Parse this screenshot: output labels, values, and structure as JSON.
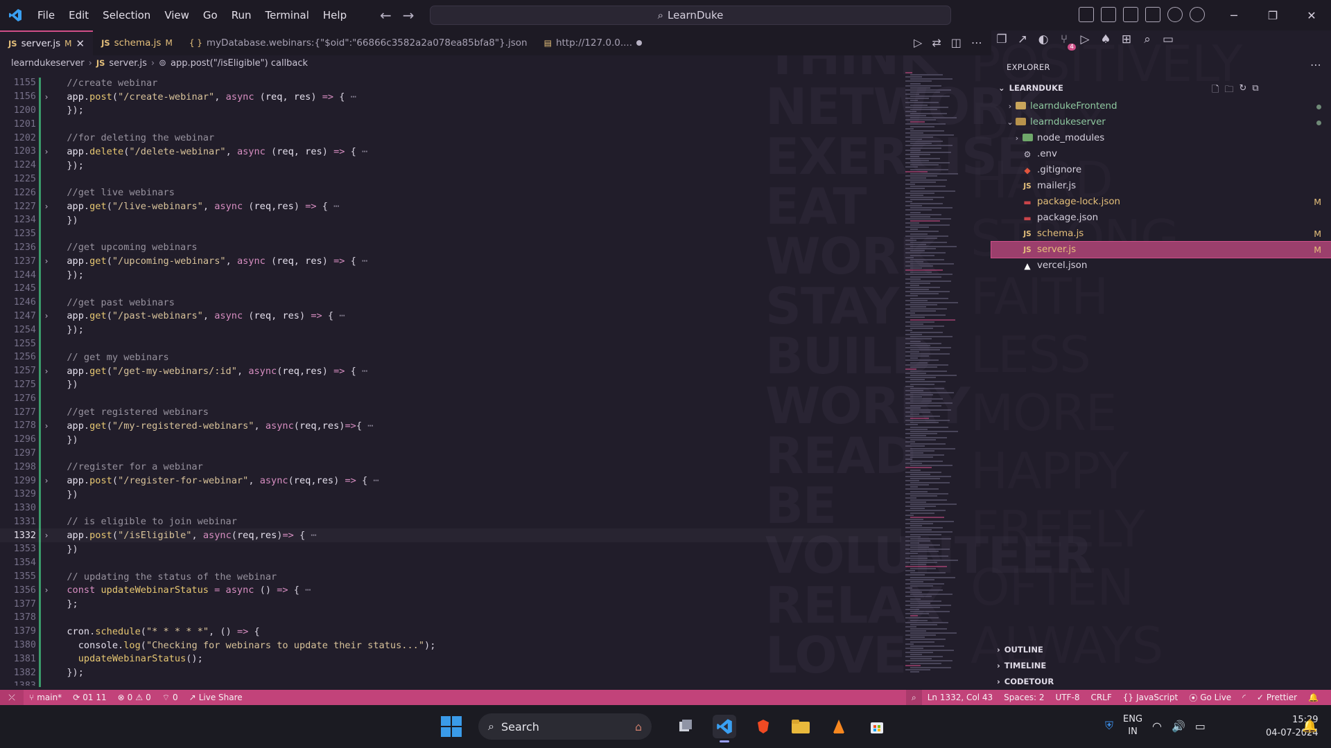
{
  "window": {
    "title": "LearnDuke",
    "menu": [
      "File",
      "Edit",
      "Selection",
      "View",
      "Go",
      "Run",
      "Terminal",
      "Help"
    ]
  },
  "tabs": [
    {
      "icon": "JS",
      "label": "server.js",
      "status": "M",
      "active": true
    },
    {
      "icon": "JS",
      "label": "schema.js",
      "status": "M",
      "active": false
    },
    {
      "icon": "{ }",
      "label": "myDatabase.webinars:{\"$oid\":\"66866c3582a2a078ea85bfa8\"}.json",
      "status": "",
      "active": false
    },
    {
      "icon": "",
      "label": "http://127.0.0....",
      "status": "",
      "active": false
    }
  ],
  "breadcrumb": {
    "folder": "learndukeserver",
    "file": "server.js",
    "symbol": "app.post(\"/isEligible\") callback"
  },
  "code_lines": [
    {
      "ln": "1155",
      "fold": "",
      "html": "  <span class='c'>//create webinar</span>"
    },
    {
      "ln": "1156",
      "fold": "›",
      "html": "  <span class='p'>app</span>.<span class='f'>post</span>(<span class='s'>\"/create-webinar\"</span>, <span class='k'>async</span> (<span class='p'>req</span>, <span class='p'>res</span>) <span class='k'>=&gt;</span> { <span class='ell'>⋯</span>"
    },
    {
      "ln": "1200",
      "fold": "",
      "html": "  });"
    },
    {
      "ln": "1201",
      "fold": "",
      "html": ""
    },
    {
      "ln": "1202",
      "fold": "",
      "html": "  <span class='c'>//for deleting the webinar</span>"
    },
    {
      "ln": "1203",
      "fold": "›",
      "html": "  <span class='p'>app</span>.<span class='f'>delete</span>(<span class='s'>\"/delete-webinar\"</span>, <span class='k'>async</span> (<span class='p'>req</span>, <span class='p'>res</span>) <span class='k'>=&gt;</span> { <span class='ell'>⋯</span>"
    },
    {
      "ln": "1224",
      "fold": "",
      "html": "  });"
    },
    {
      "ln": "1225",
      "fold": "",
      "html": ""
    },
    {
      "ln": "1226",
      "fold": "",
      "html": "  <span class='c'>//get live webinars</span>"
    },
    {
      "ln": "1227",
      "fold": "›",
      "html": "  <span class='p'>app</span>.<span class='f'>get</span>(<span class='s'>\"/live-webinars\"</span>, <span class='k'>async</span> (<span class='p'>req</span>,<span class='p'>res</span>) <span class='k'>=&gt;</span> { <span class='ell'>⋯</span>"
    },
    {
      "ln": "1234",
      "fold": "",
      "html": "  })"
    },
    {
      "ln": "1235",
      "fold": "",
      "html": ""
    },
    {
      "ln": "1236",
      "fold": "",
      "html": "  <span class='c'>//get upcoming webinars</span>"
    },
    {
      "ln": "1237",
      "fold": "›",
      "html": "  <span class='p'>app</span>.<span class='f'>get</span>(<span class='s'>\"/upcoming-webinars\"</span>, <span class='k'>async</span> (<span class='p'>req</span>, <span class='p'>res</span>) <span class='k'>=&gt;</span> { <span class='ell'>⋯</span>"
    },
    {
      "ln": "1244",
      "fold": "",
      "html": "  });"
    },
    {
      "ln": "1245",
      "fold": "",
      "html": ""
    },
    {
      "ln": "1246",
      "fold": "",
      "html": "  <span class='c'>//get past webinars</span>"
    },
    {
      "ln": "1247",
      "fold": "›",
      "html": "  <span class='p'>app</span>.<span class='f'>get</span>(<span class='s'>\"/past-webinars\"</span>, <span class='k'>async</span> (<span class='p'>req</span>, <span class='p'>res</span>) <span class='k'>=&gt;</span> { <span class='ell'>⋯</span>"
    },
    {
      "ln": "1254",
      "fold": "",
      "html": "  });"
    },
    {
      "ln": "1255",
      "fold": "",
      "html": ""
    },
    {
      "ln": "1256",
      "fold": "",
      "html": "  <span class='c'>// get my webinars</span>"
    },
    {
      "ln": "1257",
      "fold": "›",
      "html": "  <span class='p'>app</span>.<span class='f'>get</span>(<span class='s'>\"/get-my-webinars/:id\"</span>, <span class='k'>async</span>(<span class='p'>req</span>,<span class='p'>res</span>) <span class='k'>=&gt;</span> { <span class='ell'>⋯</span>"
    },
    {
      "ln": "1275",
      "fold": "",
      "html": "  })"
    },
    {
      "ln": "1276",
      "fold": "",
      "html": ""
    },
    {
      "ln": "1277",
      "fold": "",
      "html": "  <span class='c'>//get registered webinars</span>"
    },
    {
      "ln": "1278",
      "fold": "›",
      "html": "  <span class='p'>app</span>.<span class='f'>get</span>(<span class='s'>\"/my-registered-webinars\"</span>, <span class='k'>async</span>(<span class='p'>req</span>,<span class='p'>res</span>)<span class='k'>=&gt;</span>{ <span class='ell'>⋯</span>"
    },
    {
      "ln": "1296",
      "fold": "",
      "html": "  })"
    },
    {
      "ln": "1297",
      "fold": "",
      "html": ""
    },
    {
      "ln": "1298",
      "fold": "",
      "html": "  <span class='c'>//register for a webinar</span>"
    },
    {
      "ln": "1299",
      "fold": "›",
      "html": "  <span class='p'>app</span>.<span class='f'>post</span>(<span class='s'>\"/register-for-webinar\"</span>, <span class='k'>async</span>(<span class='p'>req</span>,<span class='p'>res</span>) <span class='k'>=&gt;</span> { <span class='ell'>⋯</span>"
    },
    {
      "ln": "1329",
      "fold": "",
      "html": "  })"
    },
    {
      "ln": "1330",
      "fold": "",
      "html": ""
    },
    {
      "ln": "1331",
      "fold": "",
      "html": "  <span class='c'>// is eligible to join webinar</span>"
    },
    {
      "ln": "1332",
      "fold": "›",
      "html": "  <span class='p'>app</span>.<span class='f'>post</span>(<span class='s'>\"/isEligible\"</span>, <span class='k'>async</span>(<span class='p'>req</span>,<span class='p'>res</span>)<span class='k'>=&gt;</span> { <span class='ell'>⋯</span>",
      "current": true
    },
    {
      "ln": "1353",
      "fold": "",
      "html": "  })"
    },
    {
      "ln": "1354",
      "fold": "",
      "html": ""
    },
    {
      "ln": "1355",
      "fold": "",
      "html": "  <span class='c'>// updating the status of the webinar</span>"
    },
    {
      "ln": "1356",
      "fold": "›",
      "html": "  <span class='k'>const</span> <span class='f'>updateWebinarStatus</span> <span class='k'>=</span> <span class='k'>async</span> () <span class='k'>=&gt;</span> { <span class='ell'>⋯</span>"
    },
    {
      "ln": "1377",
      "fold": "",
      "html": "  };"
    },
    {
      "ln": "1378",
      "fold": "",
      "html": ""
    },
    {
      "ln": "1379",
      "fold": "",
      "html": "  <span class='p'>cron</span>.<span class='f'>schedule</span>(<span class='s'>\"* * * * *\"</span>, () <span class='k'>=&gt;</span> {"
    },
    {
      "ln": "1380",
      "fold": "",
      "html": "    <span class='p'>console</span>.<span class='f'>log</span>(<span class='s'>\"Checking for webinars to update their status...\"</span>);"
    },
    {
      "ln": "1381",
      "fold": "",
      "html": "    <span class='f'>updateWebinarStatus</span>();"
    },
    {
      "ln": "1382",
      "fold": "",
      "html": "  });"
    },
    {
      "ln": "1383",
      "fold": "",
      "html": ""
    }
  ],
  "explorer": {
    "title": "EXPLORER",
    "root": "LEARNDUKE",
    "items": [
      {
        "label": "learndukeFrontend",
        "type": "folder",
        "depth": 0,
        "chev": "›",
        "git": "dot"
      },
      {
        "label": "learndukeserver",
        "type": "folder-open",
        "depth": 0,
        "chev": "⌄",
        "git": "dot"
      },
      {
        "label": "node_modules",
        "type": "folder",
        "depth": 1,
        "chev": "›",
        "git": ""
      },
      {
        "label": ".env",
        "type": "gear",
        "depth": 1,
        "chev": "",
        "git": ""
      },
      {
        "label": ".gitignore",
        "type": "git",
        "depth": 1,
        "chev": "",
        "git": ""
      },
      {
        "label": "mailer.js",
        "type": "js",
        "depth": 1,
        "chev": "",
        "git": ""
      },
      {
        "label": "package-lock.json",
        "type": "npm",
        "depth": 1,
        "chev": "",
        "git": "M"
      },
      {
        "label": "package.json",
        "type": "npm",
        "depth": 1,
        "chev": "",
        "git": ""
      },
      {
        "label": "schema.js",
        "type": "js",
        "depth": 1,
        "chev": "",
        "git": "M"
      },
      {
        "label": "server.js",
        "type": "js",
        "depth": 1,
        "chev": "",
        "git": "M",
        "selected": true
      },
      {
        "label": "vercel.json",
        "type": "vercel",
        "depth": 1,
        "chev": "",
        "git": ""
      }
    ],
    "panels": [
      "OUTLINE",
      "TIMELINE",
      "CODETOUR"
    ]
  },
  "statusbar": {
    "branch": "main*",
    "sync": "01 11",
    "errors": "0",
    "warnings": "0",
    "ports": "0",
    "live_share": "Live Share",
    "position": "Ln 1332, Col 43",
    "spaces": "Spaces: 2",
    "encoding": "UTF-8",
    "eol": "CRLF",
    "language": "JavaScript",
    "go_live": "Go Live",
    "prettier": "Prettier"
  },
  "taskbar": {
    "search": "Search",
    "lang_line1": "ENG",
    "lang_line2": "IN",
    "time": "15:29",
    "date": "04-07-2024"
  },
  "wallpaper_words": [
    "THINK",
    "NETWORK",
    "EXERCISE",
    "EAT",
    "WORK",
    "STAY",
    "BUILD",
    "WORRY",
    "READ",
    "BE",
    "VOLUNTEER",
    "RELAX",
    "LOVE"
  ],
  "wallpaper_words_light": [
    "POSITIVELY",
    "DAILY",
    "HARD",
    "STRONG",
    "FAITH",
    "LESS",
    "MORE",
    "HAPPY",
    "FREELY",
    "OFTEN",
    "ALWAYS"
  ],
  "colors": {
    "accent": "#c2437a",
    "selection": "#9b3f6c",
    "background": "#211d2a"
  }
}
